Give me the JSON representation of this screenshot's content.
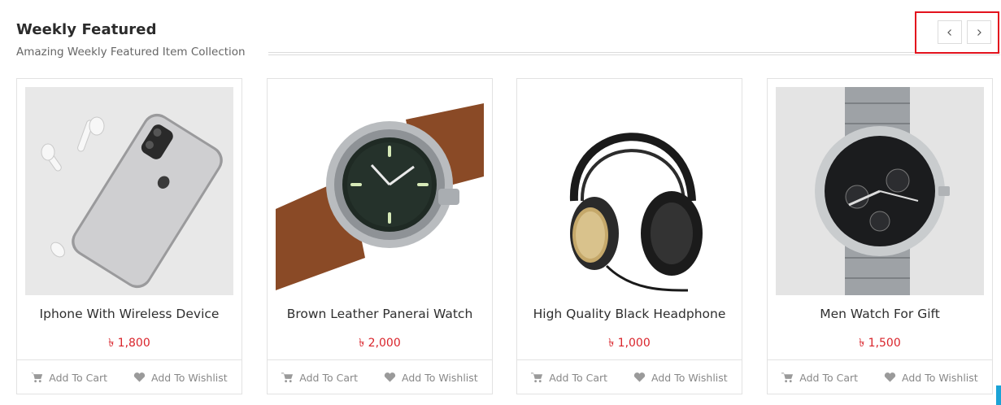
{
  "section": {
    "title": "Weekly Featured",
    "subtitle": "Amazing Weekly Featured Item Collection"
  },
  "nav": {
    "prev_icon": "chevron-left-icon",
    "next_icon": "chevron-right-icon",
    "highlight_color": "#e3121d"
  },
  "colors": {
    "price": "#d9242b",
    "accent": "#1ba3d6"
  },
  "products": [
    {
      "name": "Iphone With Wireless Device",
      "price": "৳ 1,800",
      "add_to_cart": "Add To Cart",
      "add_to_wishlist": "Add To Wishlist"
    },
    {
      "name": "Brown Leather Panerai Watch",
      "price": "৳ 2,000",
      "add_to_cart": "Add To Cart",
      "add_to_wishlist": "Add To Wishlist"
    },
    {
      "name": "High Quality Black Headphone",
      "price": "৳ 1,000",
      "add_to_cart": "Add To Cart",
      "add_to_wishlist": "Add To Wishlist"
    },
    {
      "name": "Men Watch For Gift",
      "price": "৳ 1,500",
      "add_to_cart": "Add To Cart",
      "add_to_wishlist": "Add To Wishlist"
    }
  ]
}
